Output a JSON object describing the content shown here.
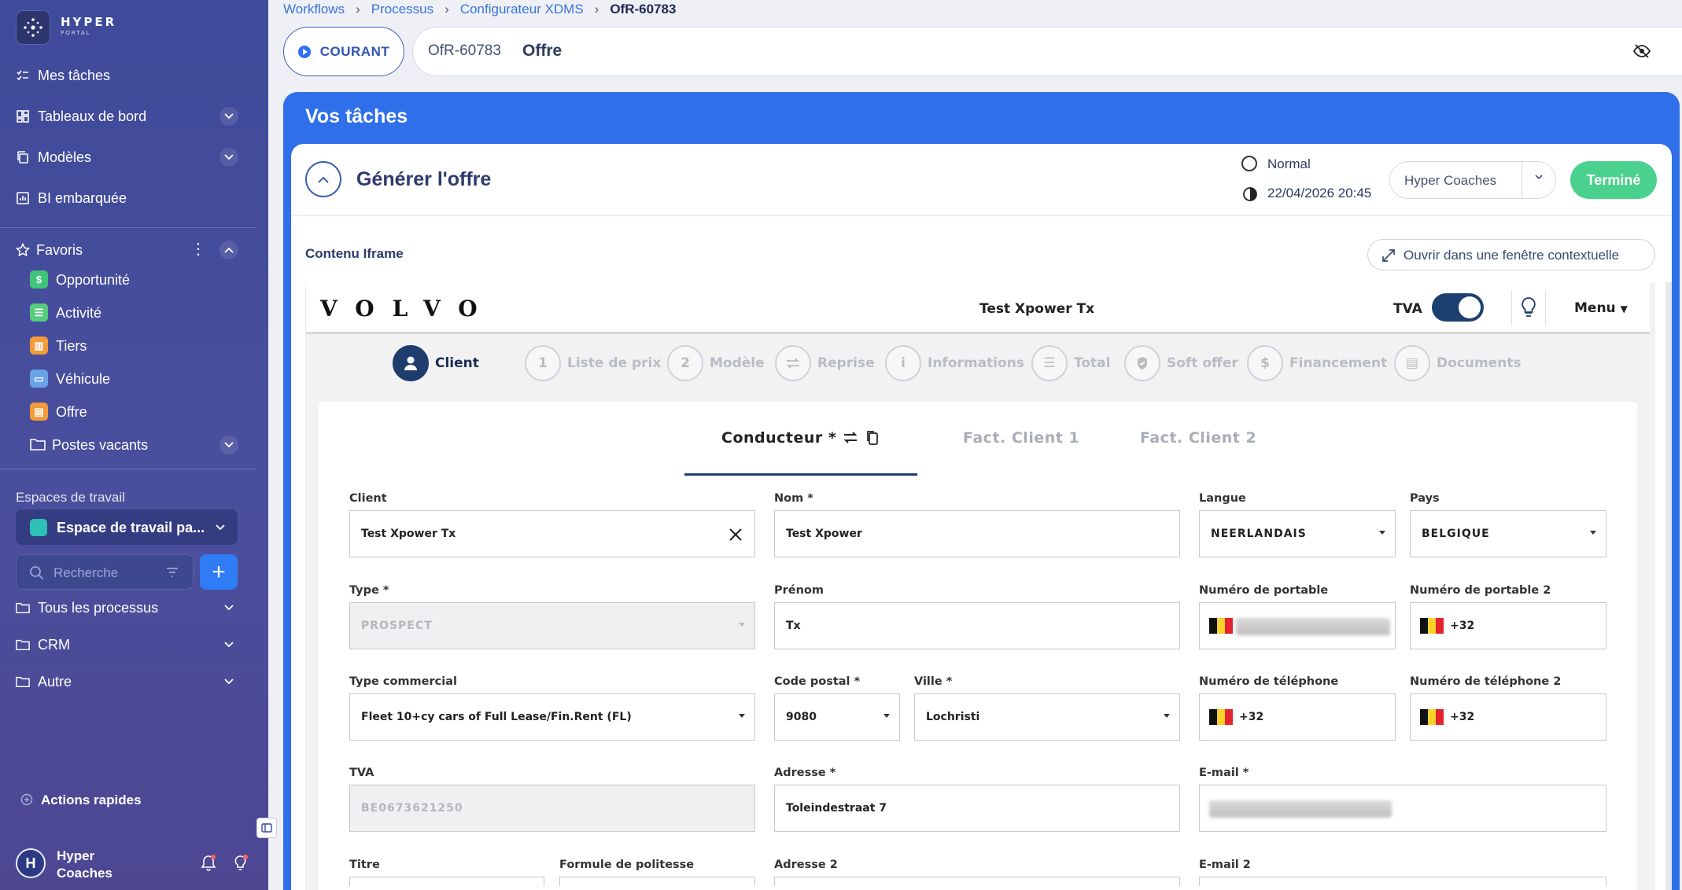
{
  "app": {
    "logo_main": "HYPER",
    "logo_sub": "PORTAL"
  },
  "sidebar": {
    "nav": [
      {
        "label": "Mes tâches",
        "icon": "checklist-icon"
      },
      {
        "label": "Tableaux de bord",
        "icon": "dashboard-icon"
      },
      {
        "label": "Modèles",
        "icon": "copy-icon"
      },
      {
        "label": "BI embarquée",
        "icon": "chart-icon"
      }
    ],
    "favorites_label": "Favoris",
    "favorites": [
      {
        "label": "Opportunité",
        "icon": "dollar-icon",
        "color": "#3fc47a"
      },
      {
        "label": "Activité",
        "icon": "list-icon",
        "color": "#56cc7c"
      },
      {
        "label": "Tiers",
        "icon": "building-icon",
        "color": "#f39a3a"
      },
      {
        "label": "Véhicule",
        "icon": "car-icon",
        "color": "#6aa2e8"
      },
      {
        "label": "Offre",
        "icon": "document-icon",
        "color": "#f39a3a"
      },
      {
        "label": "Postes vacants",
        "icon": "folder-icon",
        "color": ""
      }
    ],
    "workspace_label": "Espaces de travail",
    "workspace_value": "Espace de travail pa...",
    "search_placeholder": "Recherche",
    "add_label": "+",
    "folders": [
      {
        "label": "Tous les processus"
      },
      {
        "label": "CRM"
      },
      {
        "label": "Autre"
      }
    ],
    "quick_actions": "Actions rapides",
    "user_initial": "H",
    "user_name": "Hyper Coaches"
  },
  "breadcrumb": [
    "Workflows",
    "Processus",
    "Configurateur XDMS",
    "OfR-60783"
  ],
  "header": {
    "status": "COURANT",
    "ref": "OfR-60783",
    "kind": "Offre"
  },
  "tasks": {
    "title": "Vos tâches",
    "task_name": "Générer l'offre",
    "priority": "Normal",
    "due": "22/04/2026 20:45",
    "assignee": "Hyper Coaches",
    "done_label": "Terminé",
    "iframe_label": "Contenu Iframe",
    "popout_label": "Ouvrir dans une fenêtre contextuelle"
  },
  "iframe": {
    "brand": "VOLVO",
    "client_name": "Test Xpower Tx",
    "tva_label": "TVA",
    "tva_on": true,
    "menu_label": "Menu",
    "steps": [
      {
        "num": "",
        "label": "Client",
        "active": true
      },
      {
        "num": "1",
        "label": "Liste de prix"
      },
      {
        "num": "2",
        "label": "Modèle"
      },
      {
        "num": "",
        "label": "Reprise"
      },
      {
        "num": "",
        "label": "Informations"
      },
      {
        "num": "",
        "label": "Total"
      },
      {
        "num": "",
        "label": "Soft offer"
      },
      {
        "num": "",
        "label": "Financement"
      },
      {
        "num": "",
        "label": "Documents"
      }
    ],
    "subtabs": [
      "Conducteur *",
      "Fact. Client 1",
      "Fact. Client 2"
    ],
    "form": {
      "client_label": "Client",
      "client_value": "Test Xpower Tx",
      "nom_label": "Nom *",
      "nom_value": "Test Xpower",
      "langue_label": "Langue",
      "langue_value": "NEERLANDAIS",
      "pays_label": "Pays",
      "pays_value": "BELGIQUE",
      "type_label": "Type *",
      "type_value": "PROSPECT",
      "prenom_label": "Prénom",
      "prenom_value": "Tx",
      "mobile_label": "Numéro de portable",
      "mobile2_label": "Numéro de portable 2",
      "mobile2_value": "+32",
      "typecom_label": "Type commercial",
      "typecom_value": "Fleet 10+cy cars of Full Lease/Fin.Rent (FL)",
      "cp_label": "Code postal *",
      "cp_value": "9080",
      "ville_label": "Ville *",
      "ville_value": "Lochristi",
      "tel_label": "Numéro de téléphone",
      "tel_value": "+32",
      "tel2_label": "Numéro de téléphone 2",
      "tel2_value": "+32",
      "tva_label": "TVA",
      "tva_value": "BE0673621250",
      "adresse_label": "Adresse *",
      "adresse_value": "Toleindestraat 7",
      "email_label": "E-mail *",
      "titre_label": "Titre",
      "politesse_label": "Formule de politesse",
      "adresse2_label": "Adresse 2",
      "email2_label": "E-mail 2"
    }
  }
}
